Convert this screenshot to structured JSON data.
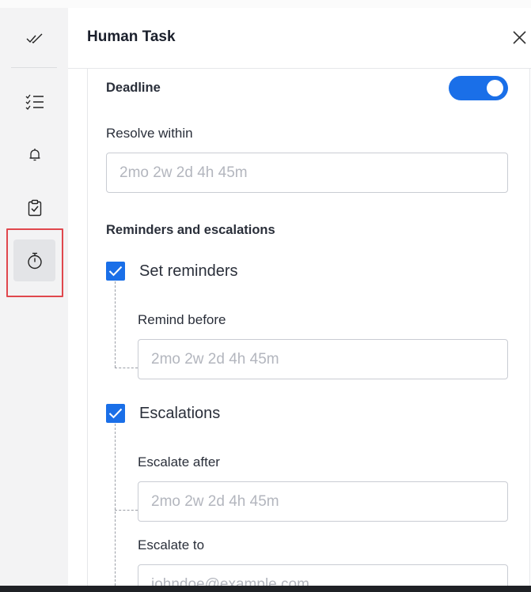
{
  "panel": {
    "title": "Human Task"
  },
  "rail": {
    "items": [
      {
        "icon": "double-check-icon"
      },
      {
        "icon": "checklist-icon"
      },
      {
        "icon": "bell-icon"
      },
      {
        "icon": "clipboard-check-icon"
      },
      {
        "icon": "stopwatch-icon",
        "active": true
      }
    ]
  },
  "deadline": {
    "label": "Deadline",
    "enabled": true,
    "resolve_within_label": "Resolve within",
    "resolve_within_placeholder": "2mo 2w 2d 4h 45m"
  },
  "reminders": {
    "section_label": "Reminders and escalations",
    "set_reminders_label": "Set reminders",
    "set_reminders_checked": true,
    "remind_before_label": "Remind before",
    "remind_before_placeholder": "2mo 2w 2d 4h 45m",
    "escalations_label": "Escalations",
    "escalations_checked": true,
    "escalate_after_label": "Escalate after",
    "escalate_after_placeholder": "2mo 2w 2d 4h 45m",
    "escalate_to_label": "Escalate to",
    "escalate_to_placeholder": "johndoe@example.com"
  },
  "colors": {
    "accent": "#1a6fe8",
    "highlight": "#e0474d"
  }
}
